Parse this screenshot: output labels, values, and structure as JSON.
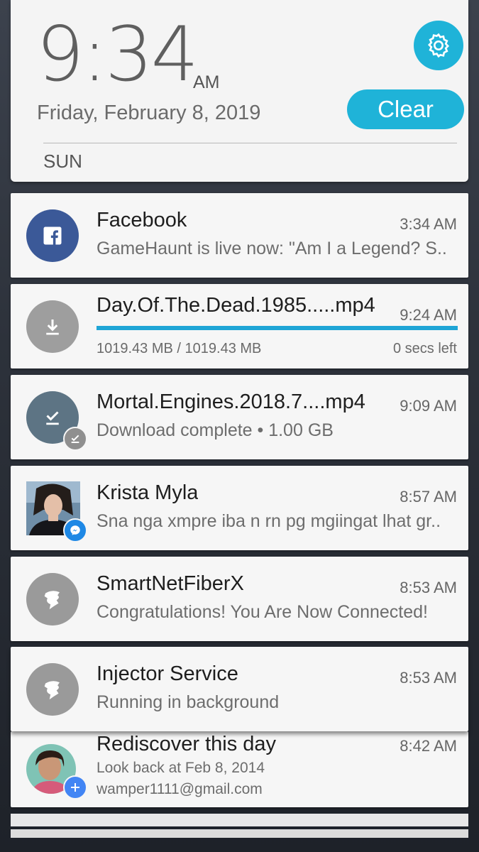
{
  "header": {
    "time": "9:34",
    "ampm": "AM",
    "date": "Friday, February 8, 2019",
    "clear_label": "Clear",
    "weather_day": "SUN",
    "settings_icon": "gear-icon",
    "accent_color": "#1fb3d8"
  },
  "notifications": [
    {
      "app": "Facebook",
      "time": "3:34 AM",
      "text": "GameHaunt is live now: \"Am I a Legend? S..",
      "icon": "facebook-icon",
      "color": "#3b5998"
    },
    {
      "title": "Day.Of.The.Dead.1985.....mp4",
      "time": "9:24 AM",
      "progress": 1.0,
      "size": "1019.43 MB / 1019.43 MB",
      "eta": "0 secs left",
      "icon": "download-icon"
    },
    {
      "title": "Mortal.Engines.2018.7....mp4",
      "time": "9:09 AM",
      "text": "Download complete • 1.00 GB",
      "icon": "download-complete-icon"
    },
    {
      "title": "Krista Myla",
      "time": "8:57 AM",
      "text": "Sna nga xmpre iba n rn pg mgiingat lhat gr..",
      "icon": "messenger-icon"
    },
    {
      "title": "SmartNetFiberX",
      "time": "8:53 AM",
      "text": "Congratulations! You Are Now Connected!",
      "icon": "vpn-icon"
    },
    {
      "title": "Injector Service",
      "time": "8:53 AM",
      "text": "Running in background",
      "icon": "vpn-icon"
    },
    {
      "title": "Rediscover this day",
      "time": "8:42 AM",
      "text": "Look back at Feb 8, 2014",
      "account": "wamper1111@gmail.com",
      "icon": "google-photos-icon"
    }
  ]
}
